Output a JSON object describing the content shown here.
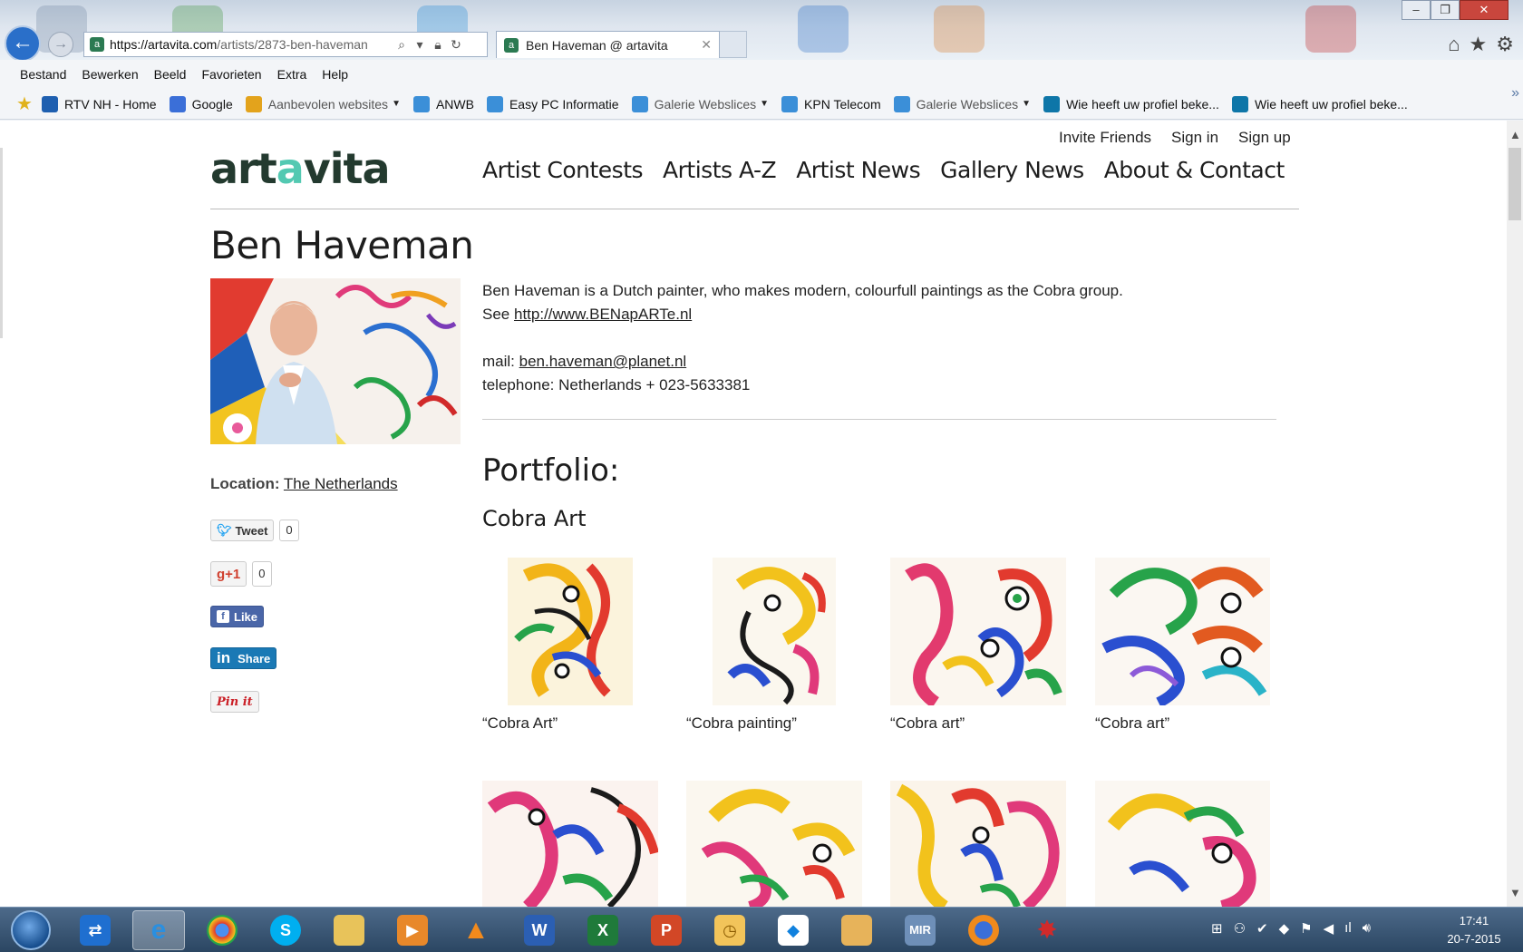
{
  "browser": {
    "url_host": "https://artavita.com",
    "url_path": "/artists/2873-ben-haveman",
    "tab_title": "Ben Haveman @ artavita",
    "menu": [
      "Bestand",
      "Bewerken",
      "Beeld",
      "Favorieten",
      "Extra",
      "Help"
    ],
    "favorites": [
      {
        "label": "RTV NH - Home",
        "icon": "rtvnh-icon",
        "color": "#1e5fb0",
        "dim": false,
        "dropdown": false
      },
      {
        "label": "Google",
        "icon": "google-icon",
        "color": "#3b6fd8",
        "dim": false,
        "dropdown": false
      },
      {
        "label": "Aanbevolen websites",
        "icon": "bing-icon",
        "color": "#e3a31c",
        "dim": true,
        "dropdown": true
      },
      {
        "label": "ANWB",
        "icon": "ie-icon",
        "color": "#3b8fd8",
        "dim": false,
        "dropdown": false
      },
      {
        "label": "Easy PC Informatie",
        "icon": "ie-icon",
        "color": "#3b8fd8",
        "dim": false,
        "dropdown": false
      },
      {
        "label": "Galerie Webslices",
        "icon": "ie-icon",
        "color": "#3b8fd8",
        "dim": true,
        "dropdown": true
      },
      {
        "label": "KPN Telecom",
        "icon": "ie-icon",
        "color": "#3b8fd8",
        "dim": false,
        "dropdown": false
      },
      {
        "label": "Galerie Webslices",
        "icon": "ie-icon",
        "color": "#3b8fd8",
        "dim": true,
        "dropdown": true
      },
      {
        "label": "Wie heeft uw profiel beke...",
        "icon": "linkedin-icon",
        "color": "#0e76a8",
        "dim": false,
        "dropdown": false
      },
      {
        "label": "Wie heeft uw profiel beke...",
        "icon": "linkedin-icon",
        "color": "#0e76a8",
        "dim": false,
        "dropdown": false
      }
    ]
  },
  "site": {
    "logo": {
      "part1": "art",
      "part2": "a",
      "part3": "vi",
      "part4": "ta"
    },
    "top_links": [
      "Invite Friends",
      "Sign in",
      "Sign up"
    ],
    "nav": [
      "Artist Contests",
      "Artists A-Z",
      "Artist News",
      "Gallery News",
      "About & Contact"
    ]
  },
  "artist": {
    "name": "Ben Haveman",
    "bio_line1": "Ben Haveman is a Dutch painter, who makes modern, colourfull paintings as the Cobra group.",
    "bio_see": "See ",
    "website": "http://www.BENapARTe.nl",
    "mail_label": "mail: ",
    "mail": "ben.haveman@planet.nl",
    "telephone": "telephone: Netherlands + 023-5633381",
    "location_label": "Location:",
    "location": "The Netherlands"
  },
  "social": {
    "tweet": "Tweet",
    "tweet_count": "0",
    "gplus": "g+1",
    "gplus_count": "0",
    "like": "Like",
    "share": "Share",
    "pin": "Pin it"
  },
  "portfolio": {
    "title": "Portfolio:",
    "gallery": "Cobra Art",
    "artworks": [
      {
        "caption": "“Cobra Art”"
      },
      {
        "caption": "“Cobra painting”"
      },
      {
        "caption": "“Cobra art”"
      },
      {
        "caption": "“Cobra art”"
      },
      {
        "caption": ""
      },
      {
        "caption": ""
      },
      {
        "caption": ""
      },
      {
        "caption": ""
      }
    ]
  },
  "taskbar": {
    "clock_time": "17:41",
    "clock_date": "20-7-2015"
  }
}
